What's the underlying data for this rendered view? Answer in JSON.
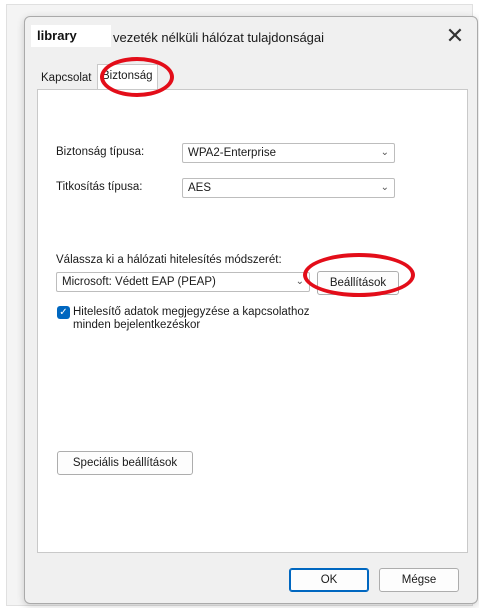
{
  "dialog": {
    "network_name": "library",
    "title": "vezeték nélküli hálózat tulajdonságai",
    "close_symbol": "✕"
  },
  "tabs": [
    {
      "label": "Kapcsolat",
      "active": false
    },
    {
      "label": "Biztonság",
      "active": true
    }
  ],
  "security": {
    "type_label": "Biztonság típusa:",
    "type_value": "WPA2-Enterprise",
    "encryption_label": "Titkosítás típusa:",
    "encryption_value": "AES",
    "auth_method_label": "Válassza ki a hálózati hitelesítés módszerét:",
    "auth_method_value": "Microsoft: Védett EAP (PEAP)",
    "settings_button": "Beállítások",
    "remember_checkbox_label": "Hitelesítő adatok megjegyzése a kapcsolathoz minden bejelentkezéskor",
    "remember_checked": true,
    "advanced_button": "Speciális beállítások"
  },
  "footer": {
    "ok_label": "OK",
    "cancel_label": "Mégse"
  },
  "annotation_color": "#e30d19"
}
